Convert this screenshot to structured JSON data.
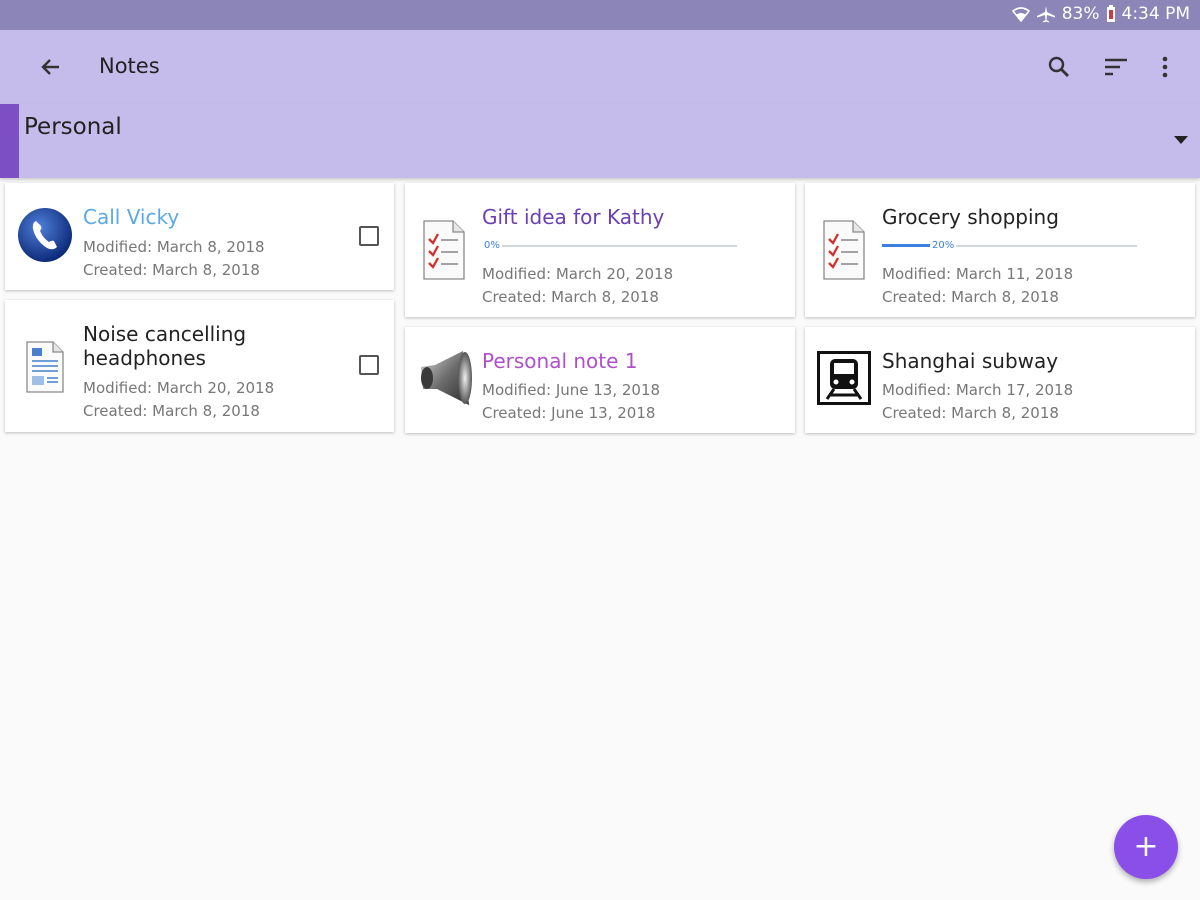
{
  "status_bar": {
    "battery": "83%",
    "time": "4:34 PM",
    "icons": [
      "wifi-icon",
      "airplane-icon",
      "battery-icon"
    ]
  },
  "app_bar": {
    "title": "Notes",
    "actions": [
      "back-arrow-icon",
      "search-icon",
      "sort-icon",
      "more-vert-icon"
    ]
  },
  "category": {
    "label": "Personal",
    "accent_color": "#7c4fc4"
  },
  "notes": [
    {
      "title": "Call Vicky",
      "title_color": "#5aa9e6",
      "modified": "Modified: March 8, 2018",
      "created": "Created: March 8, 2018",
      "icon": "phone-icon",
      "checkbox": true,
      "checked": false
    },
    {
      "title": "Noise cancelling headphones",
      "title_color": "#222222",
      "modified": "Modified: March 20, 2018",
      "created": "Created: March 8, 2018",
      "icon": "document-icon",
      "checkbox": true,
      "checked": false
    },
    {
      "title": "Gift idea for Kathy",
      "title_color": "#6a3fb5",
      "progress": 0,
      "progress_label": "0%",
      "modified": "Modified: March 20, 2018",
      "created": "Created: March 8, 2018",
      "icon": "checklist-icon"
    },
    {
      "title": "Personal note 1",
      "title_color": "#b04fc9",
      "modified": "Modified: June 13, 2018",
      "created": "Created: June 13, 2018",
      "icon": "speaker-icon"
    },
    {
      "title": "Grocery shopping",
      "title_color": "#222222",
      "progress": 0.2,
      "progress_label": "20%",
      "modified": "Modified: March 11, 2018",
      "created": "Created: March 8, 2018",
      "icon": "checklist-icon"
    },
    {
      "title": "Shanghai subway",
      "title_color": "#222222",
      "modified": "Modified: March 17, 2018",
      "created": "Created: March 8, 2018",
      "icon": "train-icon"
    }
  ],
  "fab": {
    "label": "+",
    "icon": "plus-icon",
    "color": "#8a4fe8"
  },
  "colors": {
    "app_bar": "#c5bceb",
    "status_bar": "#8c85b8",
    "progress": "#3d7fe0"
  }
}
